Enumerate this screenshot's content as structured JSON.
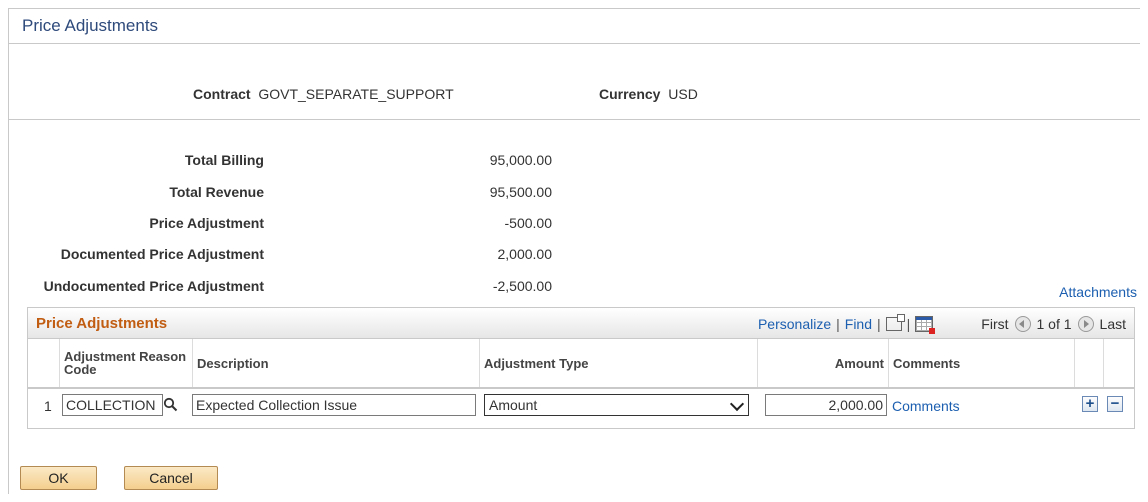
{
  "page": {
    "title": "Price Adjustments"
  },
  "contract": {
    "label": "Contract",
    "value": "GOVT_SEPARATE_SUPPORT"
  },
  "currency": {
    "label": "Currency",
    "value": "USD"
  },
  "summary": [
    {
      "label": "Total Billing",
      "value": "95,000.00"
    },
    {
      "label": "Total Revenue",
      "value": "95,500.00"
    },
    {
      "label": "Price Adjustment",
      "value": "-500.00"
    },
    {
      "label": "Documented Price Adjustment",
      "value": "2,000.00"
    },
    {
      "label": "Undocumented Price Adjustment",
      "value": "-2,500.00"
    }
  ],
  "attachments_link": "Attachments",
  "grid": {
    "title": "Price Adjustments",
    "nav": {
      "personalize": "Personalize",
      "find": "Find",
      "sep": "|",
      "first": "First",
      "page_info": "1 of 1",
      "last": "Last"
    },
    "columns": [
      "Adjustment Reason Code",
      "Description",
      "Adjustment Type",
      "Amount",
      "Comments"
    ],
    "rows": [
      {
        "num": "1",
        "reason_code": "COLLECTION",
        "description": "Expected Collection Issue",
        "adjustment_type": "Amount",
        "amount": "2,000.00",
        "comments_link": "Comments"
      }
    ],
    "add_row": "+",
    "delete_row": "−"
  },
  "buttons": {
    "ok": "OK",
    "cancel": "Cancel"
  },
  "colors": {
    "title": "#2e4a7b",
    "grid_title": "#c15d13",
    "link": "#1c5fb0",
    "button": "#f4cf8e"
  },
  "icons": [
    "lookup-icon",
    "view-all-icon",
    "download-icon",
    "first-arrow-icon",
    "last-arrow-icon",
    "add-row-icon",
    "delete-row-icon"
  ]
}
